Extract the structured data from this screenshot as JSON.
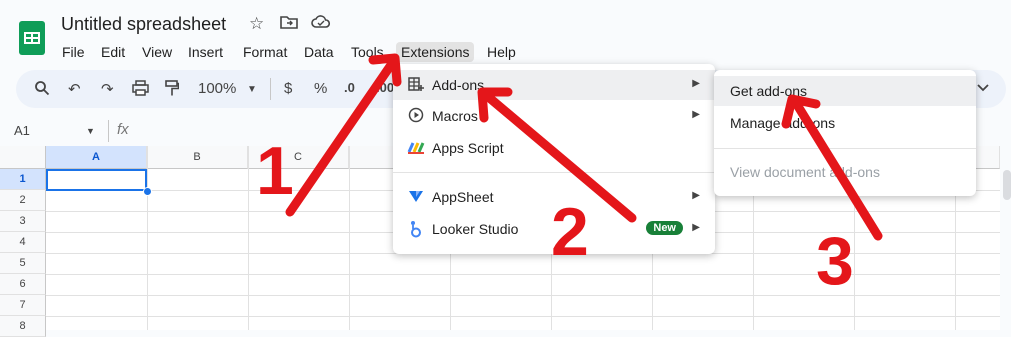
{
  "app": {
    "title": "Untitled spreadsheet",
    "title_icons": [
      "star-icon",
      "move-to-folder-icon",
      "cloud-saved-icon"
    ],
    "logo_icon": "sheets-logo-icon"
  },
  "menubar": {
    "items": [
      "File",
      "Edit",
      "View",
      "Insert",
      "Format",
      "Data",
      "Tools",
      "Extensions",
      "Help"
    ],
    "active": "Extensions"
  },
  "toolbar": {
    "zoom": "100%",
    "currency": "$",
    "percent": "%",
    "decrease_decimal": ".0",
    "increase_decimal": ".00",
    "icons": [
      "search-icon",
      "undo-icon",
      "redo-icon",
      "print-icon",
      "paint-format-icon",
      "zoom-dropdown-icon",
      "expand-icon"
    ]
  },
  "formula_bar": {
    "name_box": "A1",
    "fx": "fx"
  },
  "grid": {
    "columns": [
      "A",
      "B",
      "C"
    ],
    "rows": [
      "1",
      "2",
      "3",
      "4",
      "5",
      "6",
      "7",
      "8"
    ],
    "selected_cell": "A1"
  },
  "extensions_menu": {
    "items": [
      {
        "label": "Add-ons",
        "icon": "add-ons-icon",
        "has_submenu": true
      },
      {
        "label": "Macros",
        "icon": "macros-play-icon",
        "has_submenu": true
      },
      {
        "label": "Apps Script",
        "icon": "apps-script-icon",
        "has_submenu": false
      },
      {
        "label": "AppSheet",
        "icon": "appsheet-icon",
        "has_submenu": true
      },
      {
        "label": "Looker Studio",
        "icon": "looker-studio-icon",
        "has_submenu": true,
        "badge": "New"
      }
    ]
  },
  "addons_submenu": {
    "items": [
      {
        "label": "Get add-ons",
        "enabled": true
      },
      {
        "label": "Manage add-ons",
        "enabled": true
      },
      {
        "label": "View document add-ons",
        "enabled": false
      }
    ]
  },
  "annotations": {
    "numbers": [
      "1",
      "2",
      "3"
    ],
    "color": "#e4161a"
  },
  "colors": {
    "accent": "#1a73e8",
    "sheets_green": "#0f9d58",
    "badge_green": "#188038"
  }
}
